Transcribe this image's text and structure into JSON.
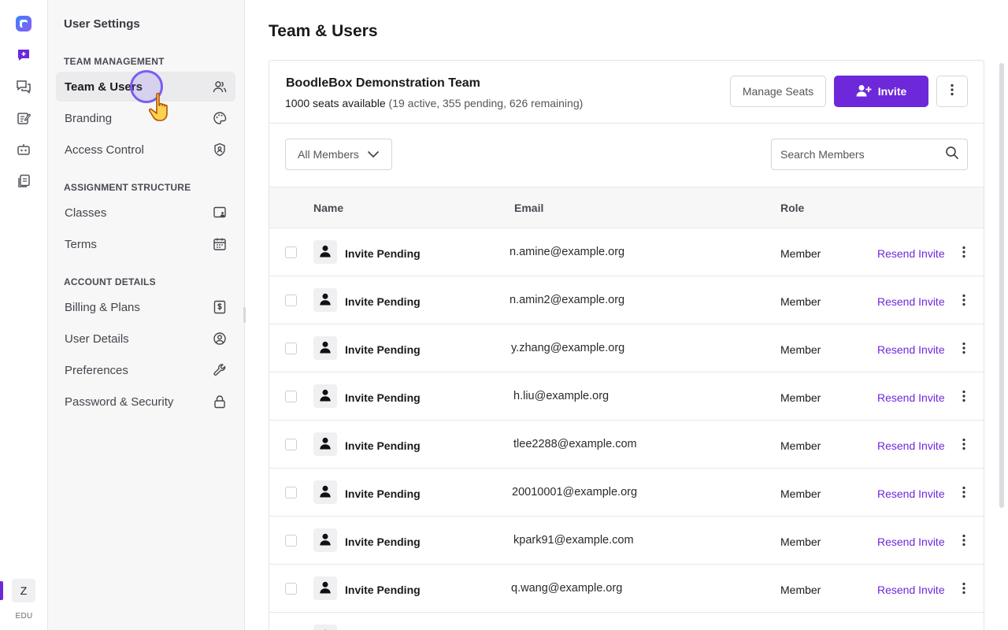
{
  "rail": {
    "avatar_letter": "Z",
    "plan_badge": "EDU",
    "icons": [
      "app-logo-icon",
      "new-chat-icon",
      "chats-icon",
      "notes-icon",
      "bot-icon",
      "files-icon"
    ]
  },
  "sidebar": {
    "title": "User Settings",
    "sections": [
      {
        "label": "TEAM MANAGEMENT",
        "items": [
          {
            "label": "Team & Users",
            "icon": "users-icon",
            "active": true
          },
          {
            "label": "Branding",
            "icon": "palette-icon"
          },
          {
            "label": "Access Control",
            "icon": "shield-icon"
          }
        ]
      },
      {
        "label": "ASSIGNMENT STRUCTURE",
        "items": [
          {
            "label": "Classes",
            "icon": "classroom-icon"
          },
          {
            "label": "Terms",
            "icon": "calendar-icon"
          }
        ]
      },
      {
        "label": "ACCOUNT DETAILS",
        "items": [
          {
            "label": "Billing & Plans",
            "icon": "billing-icon"
          },
          {
            "label": "User Details",
            "icon": "user-circle-icon"
          },
          {
            "label": "Preferences",
            "icon": "wrench-icon"
          },
          {
            "label": "Password & Security",
            "icon": "lock-icon"
          }
        ]
      }
    ]
  },
  "main": {
    "title": "Team & Users",
    "team": {
      "name": "BoodleBox Demonstration Team",
      "seats": "1000 seats available",
      "seats_detail": "(19 active, 355 pending, 626 remaining)"
    },
    "buttons": {
      "manage_seats": "Manage Seats",
      "invite": "Invite"
    },
    "filter": {
      "selected": "All Members"
    },
    "search": {
      "placeholder": "Search Members"
    },
    "columns": {
      "name": "Name",
      "email": "Email",
      "role": "Role"
    },
    "rows": [
      {
        "name": "Invite Pending",
        "email": "n.amine@example.org",
        "role": "Member",
        "action": "Resend Invite"
      },
      {
        "name": "Invite Pending",
        "email": "n.amin2@example.org",
        "role": "Member",
        "action": "Resend Invite"
      },
      {
        "name": "Invite Pending",
        "email": "y.zhang@example.org",
        "role": "Member",
        "action": "Resend Invite"
      },
      {
        "name": "Invite Pending",
        "email": "h.liu@example.org",
        "role": "Member",
        "action": "Resend Invite"
      },
      {
        "name": "Invite Pending",
        "email": "tlee2288@example.com",
        "role": "Member",
        "action": "Resend Invite"
      },
      {
        "name": "Invite Pending",
        "email": "20010001@example.org",
        "role": "Member",
        "action": "Resend Invite"
      },
      {
        "name": "Invite Pending",
        "email": "kpark91@example.com",
        "role": "Member",
        "action": "Resend Invite"
      },
      {
        "name": "Invite Pending",
        "email": "q.wang@example.org",
        "role": "Member",
        "action": "Resend Invite"
      },
      {
        "name": "",
        "email": "",
        "role": "",
        "action": ""
      }
    ]
  },
  "colors": {
    "accent": "#6d28d9",
    "sidebar_bg": "#f7f7f8",
    "border": "#e6e6ea"
  }
}
